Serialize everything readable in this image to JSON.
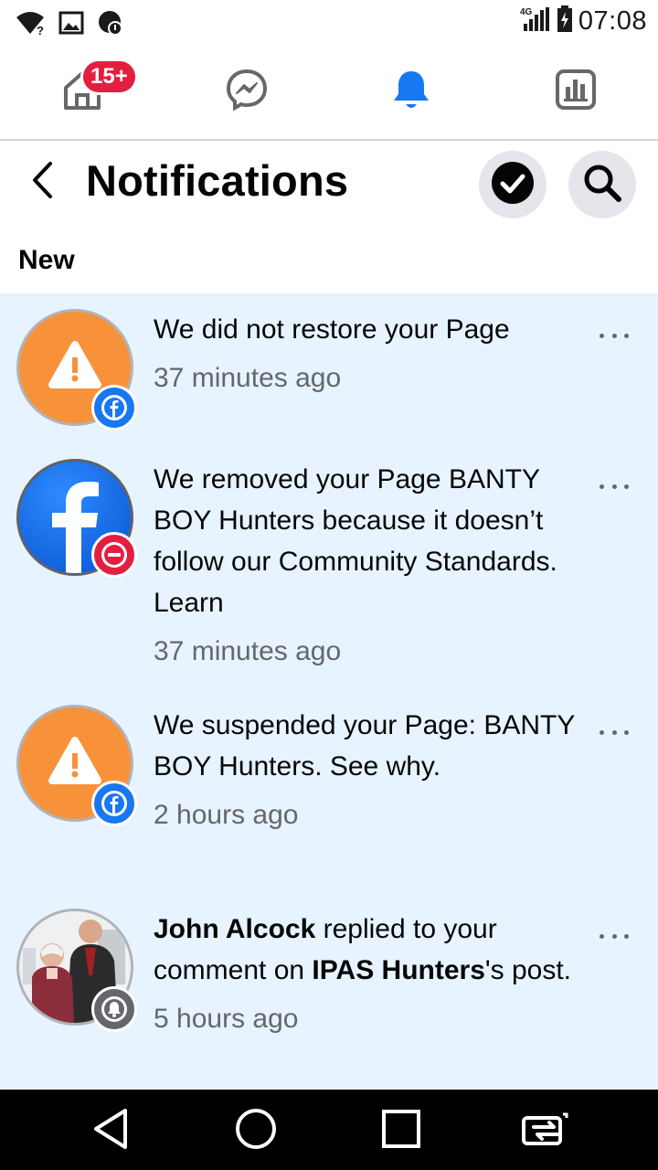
{
  "status_bar": {
    "time": "07:08",
    "network": "4G",
    "icons": [
      "wifi-question-icon",
      "image-icon",
      "vpn-icon",
      "signal-icon",
      "battery-charging-icon"
    ]
  },
  "top_nav": {
    "home_badge": "15+",
    "tabs": [
      "home-icon",
      "messenger-icon",
      "bell-icon",
      "dashboard-icon"
    ],
    "active_color": "#1877f2"
  },
  "header": {
    "title": "Notifications",
    "section_label": "New"
  },
  "notifications": [
    {
      "avatar": "warning-icon",
      "mini_badge": "facebook-icon",
      "text": "We did not restore your Page",
      "time": "37 minutes ago"
    },
    {
      "avatar": "facebook-logo-icon",
      "mini_badge": "blocked-icon",
      "text": "We removed your Page BANTY BOY  Hunters because it doesn’t follow our Community Standards. Learn",
      "time": "37 minutes ago"
    },
    {
      "avatar": "warning-icon",
      "mini_badge": "facebook-icon",
      "text": "We suspended your Page: BANTY BOY  Hunters. See why.",
      "time": "2 hours ago"
    },
    {
      "avatar": "profile-photo",
      "mini_badge": "bell-icon",
      "actor": "John Alcock",
      "action_pre": " replied to your comment on ",
      "target": "IPAS Hunters",
      "action_post": "'s post.",
      "time": "5 hours ago"
    }
  ],
  "colors": {
    "unread_bg": "#e7f3ff",
    "facebook_blue": "#1877f2",
    "warning_orange": "#f7923a",
    "badge_red": "#e41e3f"
  }
}
